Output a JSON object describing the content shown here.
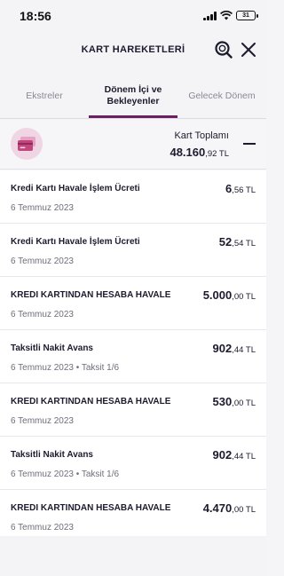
{
  "status_bar": {
    "time": "18:56",
    "battery": "31"
  },
  "header": {
    "title": "KART HAREKETLERİ"
  },
  "tabs": [
    {
      "label": "Ekstreler"
    },
    {
      "label": "Dönem İçi ve Bekleyenler"
    },
    {
      "label": "Gelecek Dönem"
    }
  ],
  "summary": {
    "label": "Kart Toplamı",
    "amount_main": "48.160",
    "amount_dec": ",92 TL"
  },
  "transactions": [
    {
      "title": "Kredi Kartı Havale İşlem Ücreti",
      "date": "6 Temmuz 2023",
      "amount_main": "6",
      "amount_dec": ",56 TL"
    },
    {
      "title": "Kredi Kartı Havale İşlem Ücreti",
      "date": "6 Temmuz 2023",
      "amount_main": "52",
      "amount_dec": ",54 TL"
    },
    {
      "title": "KREDI KARTINDAN HESABA HAVALE",
      "date": "6 Temmuz 2023",
      "amount_main": "5.000",
      "amount_dec": ",00 TL"
    },
    {
      "title": "Taksitli Nakit Avans",
      "date": "6 Temmuz 2023 • Taksit 1/6",
      "amount_main": "902",
      "amount_dec": ",44 TL"
    },
    {
      "title": "KREDI KARTINDAN HESABA HAVALE",
      "date": "6 Temmuz 2023",
      "amount_main": "530",
      "amount_dec": ",00 TL"
    },
    {
      "title": "Taksitli Nakit Avans",
      "date": "6 Temmuz 2023 • Taksit 1/6",
      "amount_main": "902",
      "amount_dec": ",44 TL"
    },
    {
      "title": "KREDI KARTINDAN HESABA HAVALE",
      "date": "6 Temmuz 2023",
      "amount_main": "4.470",
      "amount_dec": ",00 TL"
    }
  ],
  "colors": {
    "accent": "#6a1f63",
    "card_icon_bg": "#f0d5e4",
    "card_icon": "#c2457e"
  },
  "icons": {
    "search": "search-icon",
    "close": "close-icon",
    "card": "credit-card-icon",
    "collapse": "minus-icon"
  }
}
